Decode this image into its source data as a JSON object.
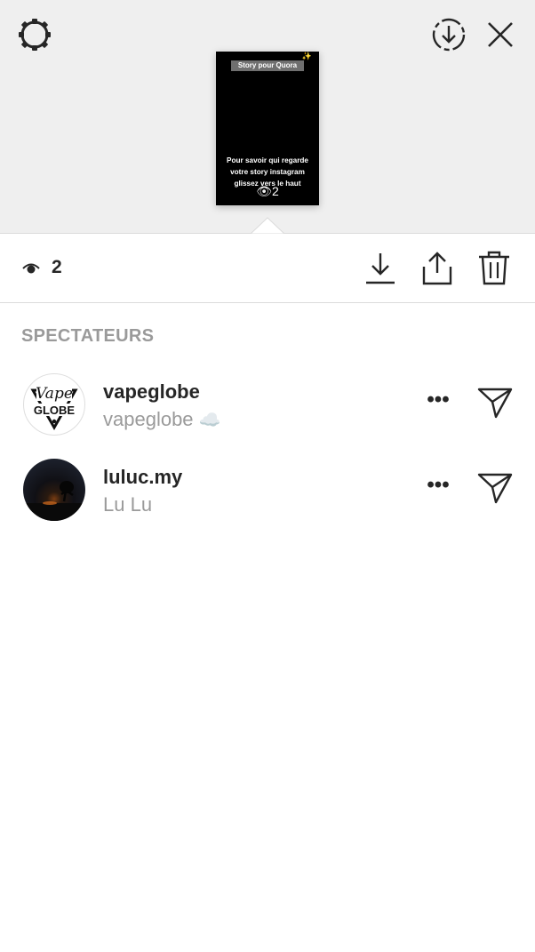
{
  "header": {
    "settings_icon": "gear-icon",
    "download_icon": "download-circle-icon",
    "close_icon": "close-icon"
  },
  "story_preview": {
    "tag": "Story pour Quora",
    "sparkle": "✨",
    "text": "Pour savoir qui regarde votre story instagram glissez vers le haut",
    "count_eye": "👁",
    "count": "2"
  },
  "stats": {
    "view_count": "2",
    "actions": [
      "download-icon",
      "share-icon",
      "trash-icon"
    ]
  },
  "section": {
    "title": "SPECTATEURS"
  },
  "viewers": [
    {
      "username": "vapeglobe",
      "fullname": "vapeglobe",
      "emoji": "☁️",
      "avatar_text_top": "Vape",
      "avatar_text_bottom": "GLOBE",
      "more": "•••"
    },
    {
      "username": "luluc.my",
      "fullname": "Lu Lu",
      "more": "•••"
    }
  ]
}
